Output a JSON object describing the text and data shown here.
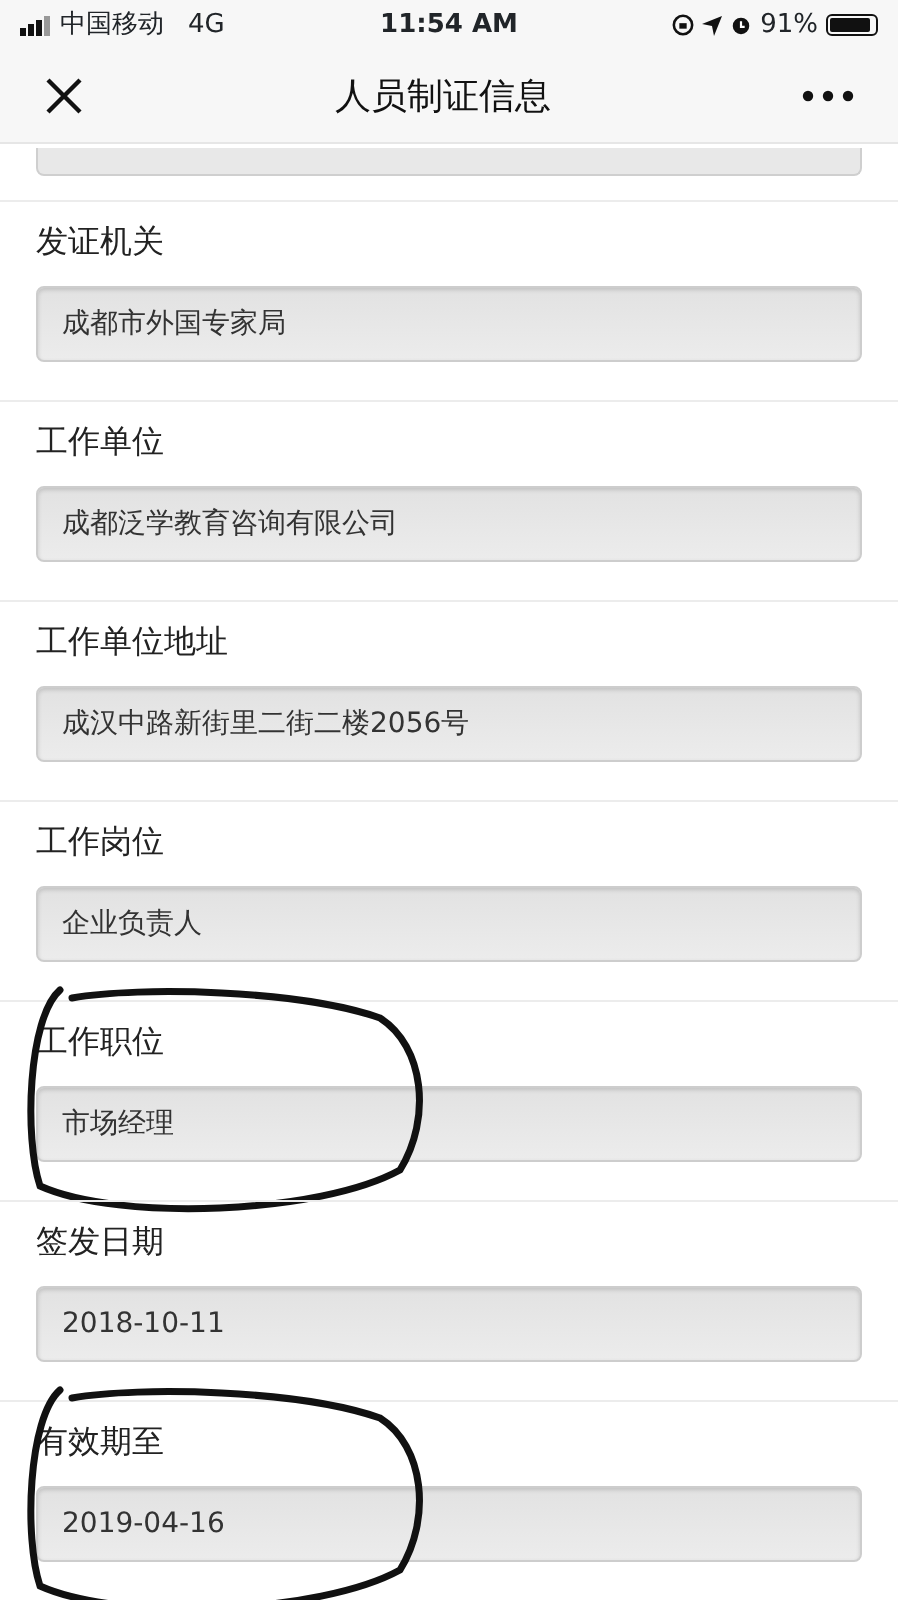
{
  "status_bar": {
    "carrier": "中国移动",
    "network": "4G",
    "time": "11:54 AM",
    "battery": "91%"
  },
  "nav": {
    "title": "人员制证信息"
  },
  "sections": [
    {
      "label": "发证机关",
      "value": "成都市外国专家局",
      "circled": false
    },
    {
      "label": "工作单位",
      "value": "成都泛学教育咨询有限公司",
      "circled": false
    },
    {
      "label": "工作单位地址",
      "value": "成汉中路新街里二街二楼2056号",
      "circled": false
    },
    {
      "label": "工作岗位",
      "value": "企业负责人",
      "circled": false
    },
    {
      "label": "工作职位",
      "value": "市场经理",
      "circled": true
    },
    {
      "label": "签发日期",
      "value": "2018-10-11",
      "circled": false
    },
    {
      "label": "有效期至",
      "value": "2019-04-16",
      "circled": true
    }
  ]
}
